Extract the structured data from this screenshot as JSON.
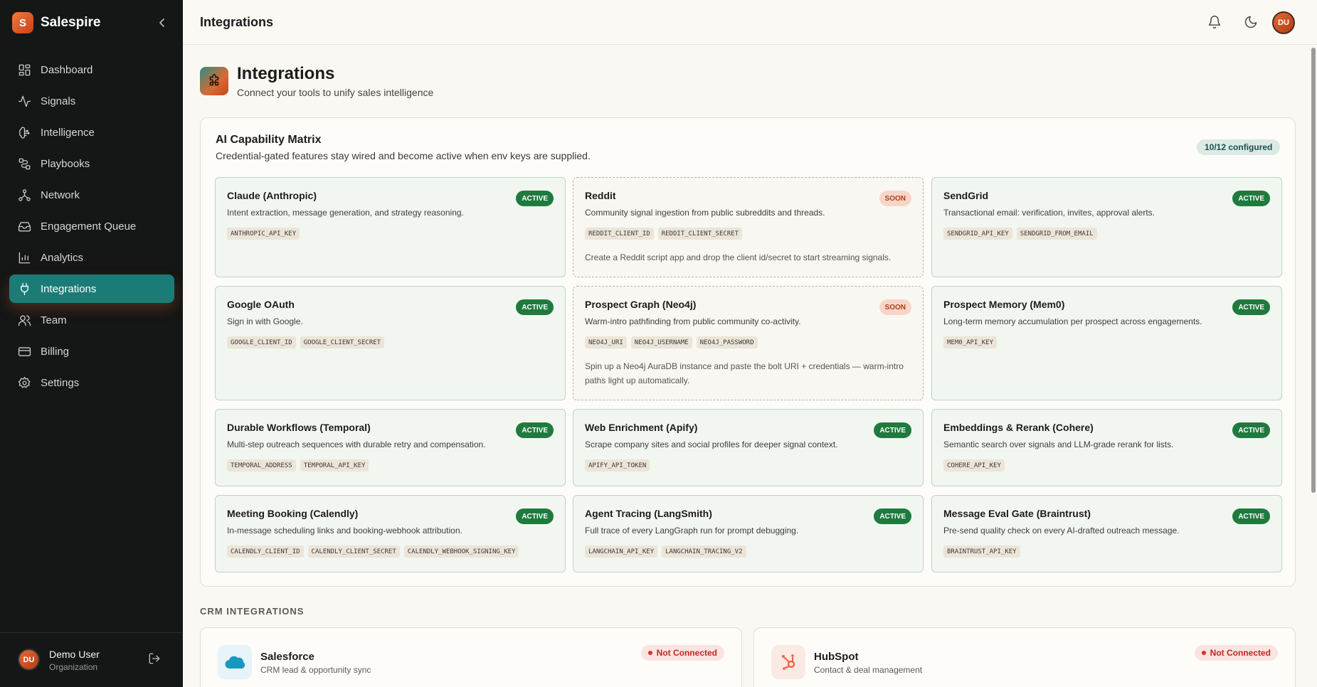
{
  "app": {
    "brand_initial": "S",
    "brand_name": "Salespire",
    "header_title": "Integrations",
    "header_avatar_initials": "DU"
  },
  "sidebar": {
    "items": [
      {
        "label": "Dashboard",
        "icon": "dashboard-icon",
        "active": false
      },
      {
        "label": "Signals",
        "icon": "activity-icon",
        "active": false
      },
      {
        "label": "Intelligence",
        "icon": "brain-icon",
        "active": false
      },
      {
        "label": "Playbooks",
        "icon": "route-icon",
        "active": false
      },
      {
        "label": "Network",
        "icon": "network-icon",
        "active": false
      },
      {
        "label": "Engagement Queue",
        "icon": "inbox-icon",
        "active": false
      },
      {
        "label": "Analytics",
        "icon": "bar-chart-icon",
        "active": false
      },
      {
        "label": "Integrations",
        "icon": "plug-icon",
        "active": true
      },
      {
        "label": "Team",
        "icon": "users-icon",
        "active": false
      },
      {
        "label": "Billing",
        "icon": "credit-card-icon",
        "active": false
      },
      {
        "label": "Settings",
        "icon": "gear-icon",
        "active": false
      }
    ],
    "user": {
      "initials": "DU",
      "name": "Demo User",
      "org": "Organization"
    }
  },
  "page": {
    "title": "Integrations",
    "subtitle": "Connect your tools to unify sales intelligence"
  },
  "matrix": {
    "title": "AI Capability Matrix",
    "subtitle": "Credential-gated features stay wired and become active when env keys are supplied.",
    "configured": "10/12 configured",
    "cards": [
      {
        "name": "Claude (Anthropic)",
        "status": "ACTIVE",
        "desc": "Intent extraction, message generation, and strategy reasoning.",
        "keys": [
          "ANTHROPIC_API_KEY"
        ],
        "note": ""
      },
      {
        "name": "Reddit",
        "status": "SOON",
        "desc": "Community signal ingestion from public subreddits and threads.",
        "keys": [
          "REDDIT_CLIENT_ID",
          "REDDIT_CLIENT_SECRET"
        ],
        "note": "Create a Reddit script app and drop the client id/secret to start streaming signals."
      },
      {
        "name": "SendGrid",
        "status": "ACTIVE",
        "desc": "Transactional email: verification, invites, approval alerts.",
        "keys": [
          "SENDGRID_API_KEY",
          "SENDGRID_FROM_EMAIL"
        ],
        "note": ""
      },
      {
        "name": "Google OAuth",
        "status": "ACTIVE",
        "desc": "Sign in with Google.",
        "keys": [
          "GOOGLE_CLIENT_ID",
          "GOOGLE_CLIENT_SECRET"
        ],
        "note": ""
      },
      {
        "name": "Prospect Graph (Neo4j)",
        "status": "SOON",
        "desc": "Warm-intro pathfinding from public community co-activity.",
        "keys": [
          "NEO4J_URI",
          "NEO4J_USERNAME",
          "NEO4J_PASSWORD"
        ],
        "note": "Spin up a Neo4j AuraDB instance and paste the bolt URI + credentials — warm-intro paths light up automatically."
      },
      {
        "name": "Prospect Memory (Mem0)",
        "status": "ACTIVE",
        "desc": "Long-term memory accumulation per prospect across engagements.",
        "keys": [
          "MEM0_API_KEY"
        ],
        "note": ""
      },
      {
        "name": "Durable Workflows (Temporal)",
        "status": "ACTIVE",
        "desc": "Multi-step outreach sequences with durable retry and compensation.",
        "keys": [
          "TEMPORAL_ADDRESS",
          "TEMPORAL_API_KEY"
        ],
        "note": ""
      },
      {
        "name": "Web Enrichment (Apify)",
        "status": "ACTIVE",
        "desc": "Scrape company sites and social profiles for deeper signal context.",
        "keys": [
          "APIFY_API_TOKEN"
        ],
        "note": ""
      },
      {
        "name": "Embeddings & Rerank (Cohere)",
        "status": "ACTIVE",
        "desc": "Semantic search over signals and LLM-grade rerank for lists.",
        "keys": [
          "COHERE_API_KEY"
        ],
        "note": ""
      },
      {
        "name": "Meeting Booking (Calendly)",
        "status": "ACTIVE",
        "desc": "In-message scheduling links and booking-webhook attribution.",
        "keys": [
          "CALENDLY_CLIENT_ID",
          "CALENDLY_CLIENT_SECRET",
          "CALENDLY_WEBHOOK_SIGNING_KEY"
        ],
        "note": ""
      },
      {
        "name": "Agent Tracing (LangSmith)",
        "status": "ACTIVE",
        "desc": "Full trace of every LangGraph run for prompt debugging.",
        "keys": [
          "LANGCHAIN_API_KEY",
          "LANGCHAIN_TRACING_V2"
        ],
        "note": ""
      },
      {
        "name": "Message Eval Gate (Braintrust)",
        "status": "ACTIVE",
        "desc": "Pre-send quality check on every AI-drafted outreach message.",
        "keys": [
          "BRAINTRUST_API_KEY"
        ],
        "note": ""
      }
    ]
  },
  "crm": {
    "heading": "CRM INTEGRATIONS",
    "items": [
      {
        "name": "Salesforce",
        "desc": "CRM lead & opportunity sync",
        "status": "Not Connected",
        "icon": "cloud-icon",
        "color": "#1798c1"
      },
      {
        "name": "HubSpot",
        "desc": "Contact & deal management",
        "status": "Not Connected",
        "icon": "hubspot-icon",
        "color": "#e8613c"
      }
    ]
  }
}
